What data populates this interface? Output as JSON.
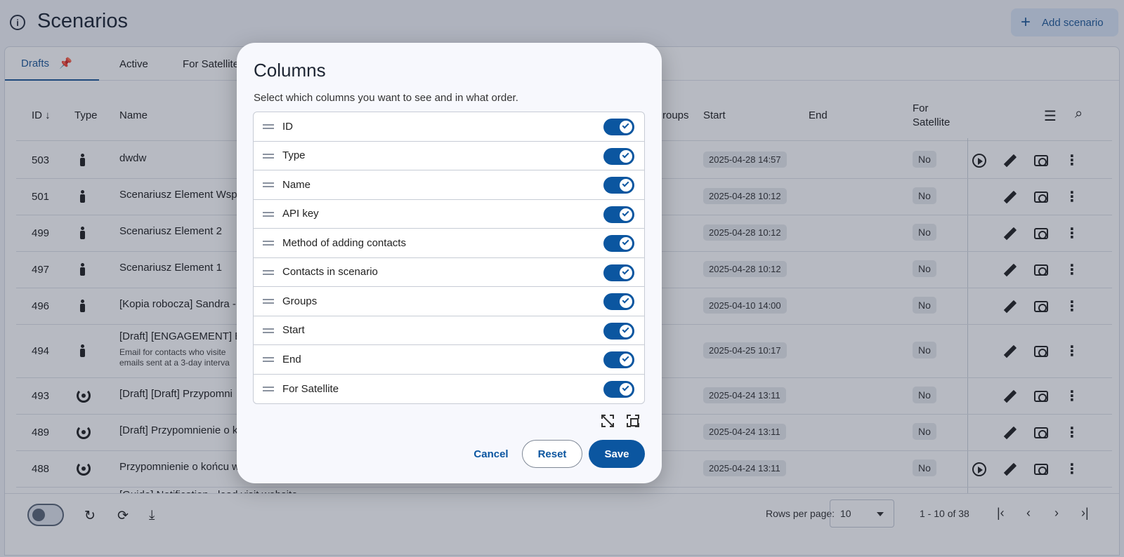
{
  "header": {
    "title": "Scenarios",
    "add_label": "Add scenario"
  },
  "tabs": [
    {
      "label": "Drafts"
    },
    {
      "label": "Active"
    },
    {
      "label": "For Satellite"
    }
  ],
  "table": {
    "columns": {
      "id": "ID",
      "type": "Type",
      "name": "Name",
      "groups": "roups",
      "start": "Start",
      "end": "End",
      "satellite_1": "For",
      "satellite_2": "Satellite"
    },
    "rows": [
      {
        "id": "503",
        "type": "person",
        "name": "dwdw",
        "sub": "",
        "start": "2025-04-28 14:57",
        "satellite": "No",
        "play": true
      },
      {
        "id": "501",
        "type": "person",
        "name": "Scenariusz Element Wspo",
        "sub": "",
        "start": "2025-04-28 10:12",
        "satellite": "No",
        "play": false
      },
      {
        "id": "499",
        "type": "person",
        "name": "Scenariusz Element 2",
        "sub": "",
        "start": "2025-04-28 10:12",
        "satellite": "No",
        "play": false
      },
      {
        "id": "497",
        "type": "person",
        "name": "Scenariusz Element 1",
        "sub": "",
        "start": "2025-04-28 10:12",
        "satellite": "No",
        "play": false
      },
      {
        "id": "496",
        "type": "person",
        "name": "[Kopia robocza] Sandra -",
        "sub": "",
        "start": "2025-04-10 14:00",
        "satellite": "No",
        "play": false
      },
      {
        "id": "494",
        "type": "person",
        "name": "[Draft] [ENGAGEMENT] En",
        "sub": "Email for contacts who visite",
        "sub2": "emails sent at a 3-day interva",
        "start": "2025-04-25 10:17",
        "satellite": "No",
        "play": false
      },
      {
        "id": "493",
        "type": "cycle",
        "name": "[Draft] [Draft] Przypomni",
        "sub": "",
        "start": "2025-04-24 13:11",
        "satellite": "No",
        "play": false
      },
      {
        "id": "489",
        "type": "cycle",
        "name": "[Draft] Przypomnienie o k",
        "sub": "",
        "start": "2025-04-24 13:11",
        "satellite": "No",
        "play": false
      },
      {
        "id": "488",
        "type": "cycle",
        "name": "Przypomnienie o końcu w",
        "sub": "",
        "start": "2025-04-24 13:11",
        "satellite": "No",
        "play": true
      },
      {
        "id": "",
        "type": "cycle",
        "name": "[Guide] Notification - lead visit website",
        "sub": "",
        "start": "",
        "satellite": "",
        "play": false
      }
    ]
  },
  "footer": {
    "rows_per_page_label": "Rows per page:",
    "rows_per_page": "10",
    "range": "1 - 10 of 38"
  },
  "modal": {
    "title": "Columns",
    "description": "Select which columns you want to see and in what order.",
    "columns": [
      {
        "label": "ID",
        "enabled": true
      },
      {
        "label": "Type",
        "enabled": true
      },
      {
        "label": "Name",
        "enabled": true
      },
      {
        "label": "API key",
        "enabled": true
      },
      {
        "label": "Method of adding contacts",
        "enabled": true
      },
      {
        "label": "Contacts in scenario",
        "enabled": true
      },
      {
        "label": "Groups",
        "enabled": true
      },
      {
        "label": "Start",
        "enabled": true
      },
      {
        "label": "End",
        "enabled": true
      },
      {
        "label": "For Satellite",
        "enabled": true
      }
    ],
    "cancel_label": "Cancel",
    "reset_label": "Reset",
    "save_label": "Save"
  },
  "icons": {
    "info": "info-icon",
    "plus": "plus-icon",
    "pin": "pin-icon",
    "sort": "arrow-down-icon",
    "filter": "sliders-icon",
    "search": "search-icon",
    "play": "play-icon",
    "edit": "pencil-icon",
    "preview": "eye-icon",
    "more": "more-vert-icon",
    "refresh": "refresh-icon",
    "sync": "sync-icon",
    "download": "download-icon",
    "drag": "drag-handle-icon",
    "deselect": "deselect-all-icon",
    "select": "select-all-icon"
  },
  "colors": {
    "accent": "#0b56a0",
    "background": "#f3f5fa",
    "overlay": "#1e2841"
  }
}
